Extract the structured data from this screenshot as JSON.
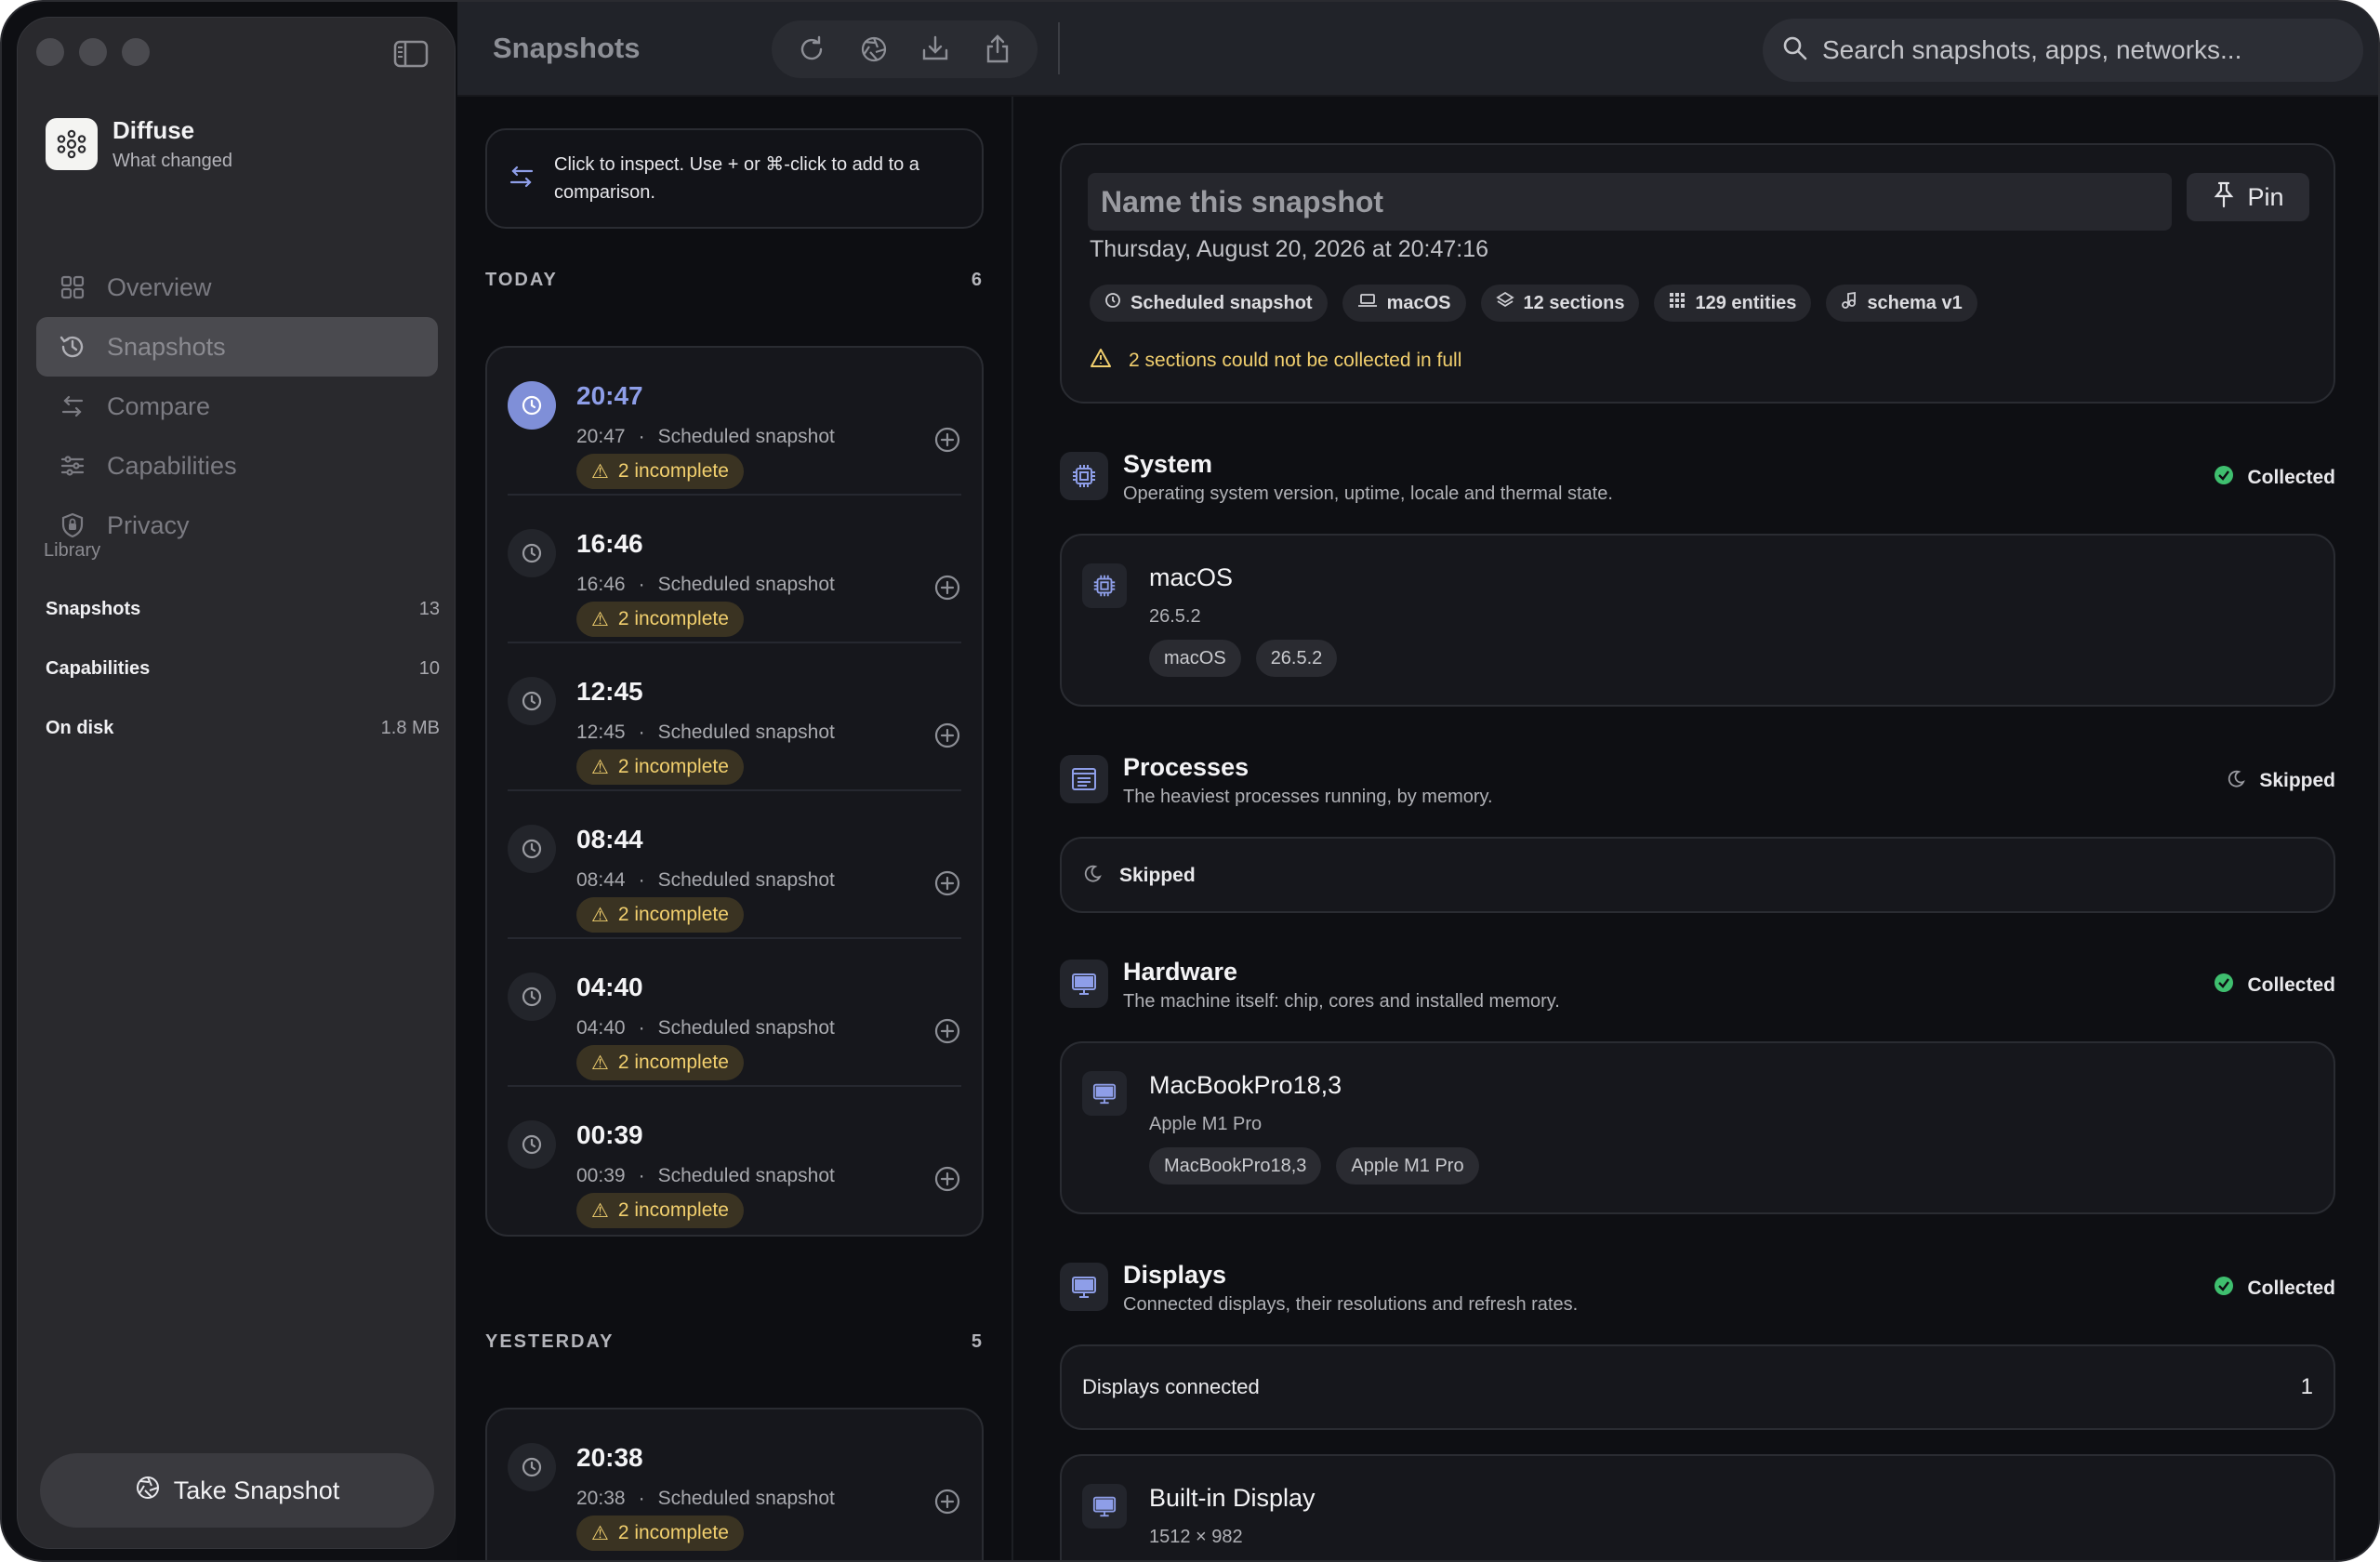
{
  "app": {
    "name": "Diffuse",
    "subtitle": "What changed"
  },
  "toolbar": {
    "title": "Snapshots",
    "search_placeholder": "Search snapshots, apps, networks..."
  },
  "nav": [
    {
      "label": "Overview",
      "icon": "grid-icon"
    },
    {
      "label": "Snapshots",
      "icon": "history-icon",
      "active": true
    },
    {
      "label": "Compare",
      "icon": "arrows-swap-icon"
    },
    {
      "label": "Capabilities",
      "icon": "sliders-icon"
    },
    {
      "label": "Privacy",
      "icon": "shield-icon"
    }
  ],
  "library": {
    "title": "Library",
    "rows": [
      {
        "label": "Snapshots",
        "value": "13"
      },
      {
        "label": "Capabilities",
        "value": "10"
      },
      {
        "label": "On disk",
        "value": "1.8 MB"
      }
    ]
  },
  "take_snapshot": "Take Snapshot",
  "hint": "Click to inspect. Use + or ⌘-click to add to a comparison.",
  "groups": {
    "today": {
      "label": "TODAY",
      "count": "6",
      "rows": [
        {
          "time": "20:47",
          "sub_time": "20:47",
          "kind": "Scheduled snapshot",
          "badge": "2 incomplete",
          "selected": true
        },
        {
          "time": "16:46",
          "sub_time": "16:46",
          "kind": "Scheduled snapshot",
          "badge": "2 incomplete"
        },
        {
          "time": "12:45",
          "sub_time": "12:45",
          "kind": "Scheduled snapshot",
          "badge": "2 incomplete"
        },
        {
          "time": "08:44",
          "sub_time": "08:44",
          "kind": "Scheduled snapshot",
          "badge": "2 incomplete"
        },
        {
          "time": "04:40",
          "sub_time": "04:40",
          "kind": "Scheduled snapshot",
          "badge": "2 incomplete"
        },
        {
          "time": "00:39",
          "sub_time": "00:39",
          "kind": "Scheduled snapshot",
          "badge": "2 incomplete"
        }
      ]
    },
    "yesterday": {
      "label": "YESTERDAY",
      "count": "5",
      "rows": [
        {
          "time": "20:38",
          "sub_time": "20:38",
          "kind": "Scheduled snapshot",
          "badge": "2 incomplete"
        }
      ]
    }
  },
  "detail": {
    "name_placeholder": "Name this snapshot",
    "pin": "Pin",
    "date": "Thursday, August 20, 2026 at 20:47:16",
    "chips": [
      {
        "label": "Scheduled snapshot",
        "icon": "clock-icon"
      },
      {
        "label": "macOS",
        "icon": "laptop-icon"
      },
      {
        "label": "12 sections",
        "icon": "layers-icon"
      },
      {
        "label": "129 entities",
        "icon": "grid-dots-icon"
      },
      {
        "label": "schema v1",
        "icon": "music-note-icon"
      }
    ],
    "warning": "2 sections could not be collected in full",
    "sections": {
      "system": {
        "title": "System",
        "desc": "Operating system version, uptime, locale and thermal state.",
        "status": "Collected",
        "card": {
          "title": "macOS",
          "sub": "26.5.2",
          "tags": [
            "macOS",
            "26.5.2"
          ]
        }
      },
      "processes": {
        "title": "Processes",
        "desc": "The heaviest processes running, by memory.",
        "status": "Skipped",
        "card_label": "Skipped"
      },
      "hardware": {
        "title": "Hardware",
        "desc": "The machine itself: chip, cores and installed memory.",
        "status": "Collected",
        "card": {
          "title": "MacBookPro18,3",
          "sub": "Apple M1 Pro",
          "tags": [
            "MacBookPro18,3",
            "Apple M1 Pro"
          ]
        }
      },
      "displays": {
        "title": "Displays",
        "desc": "Connected displays, their resolutions and refresh rates.",
        "status": "Collected",
        "summary_label": "Displays connected",
        "summary_value": "1",
        "card": {
          "title": "Built-in Display",
          "sub": "1512 × 982"
        }
      }
    }
  },
  "colors": {
    "accent": "#8e9ee8",
    "warning": "#f1cf6e",
    "success": "#3fbf6f"
  }
}
